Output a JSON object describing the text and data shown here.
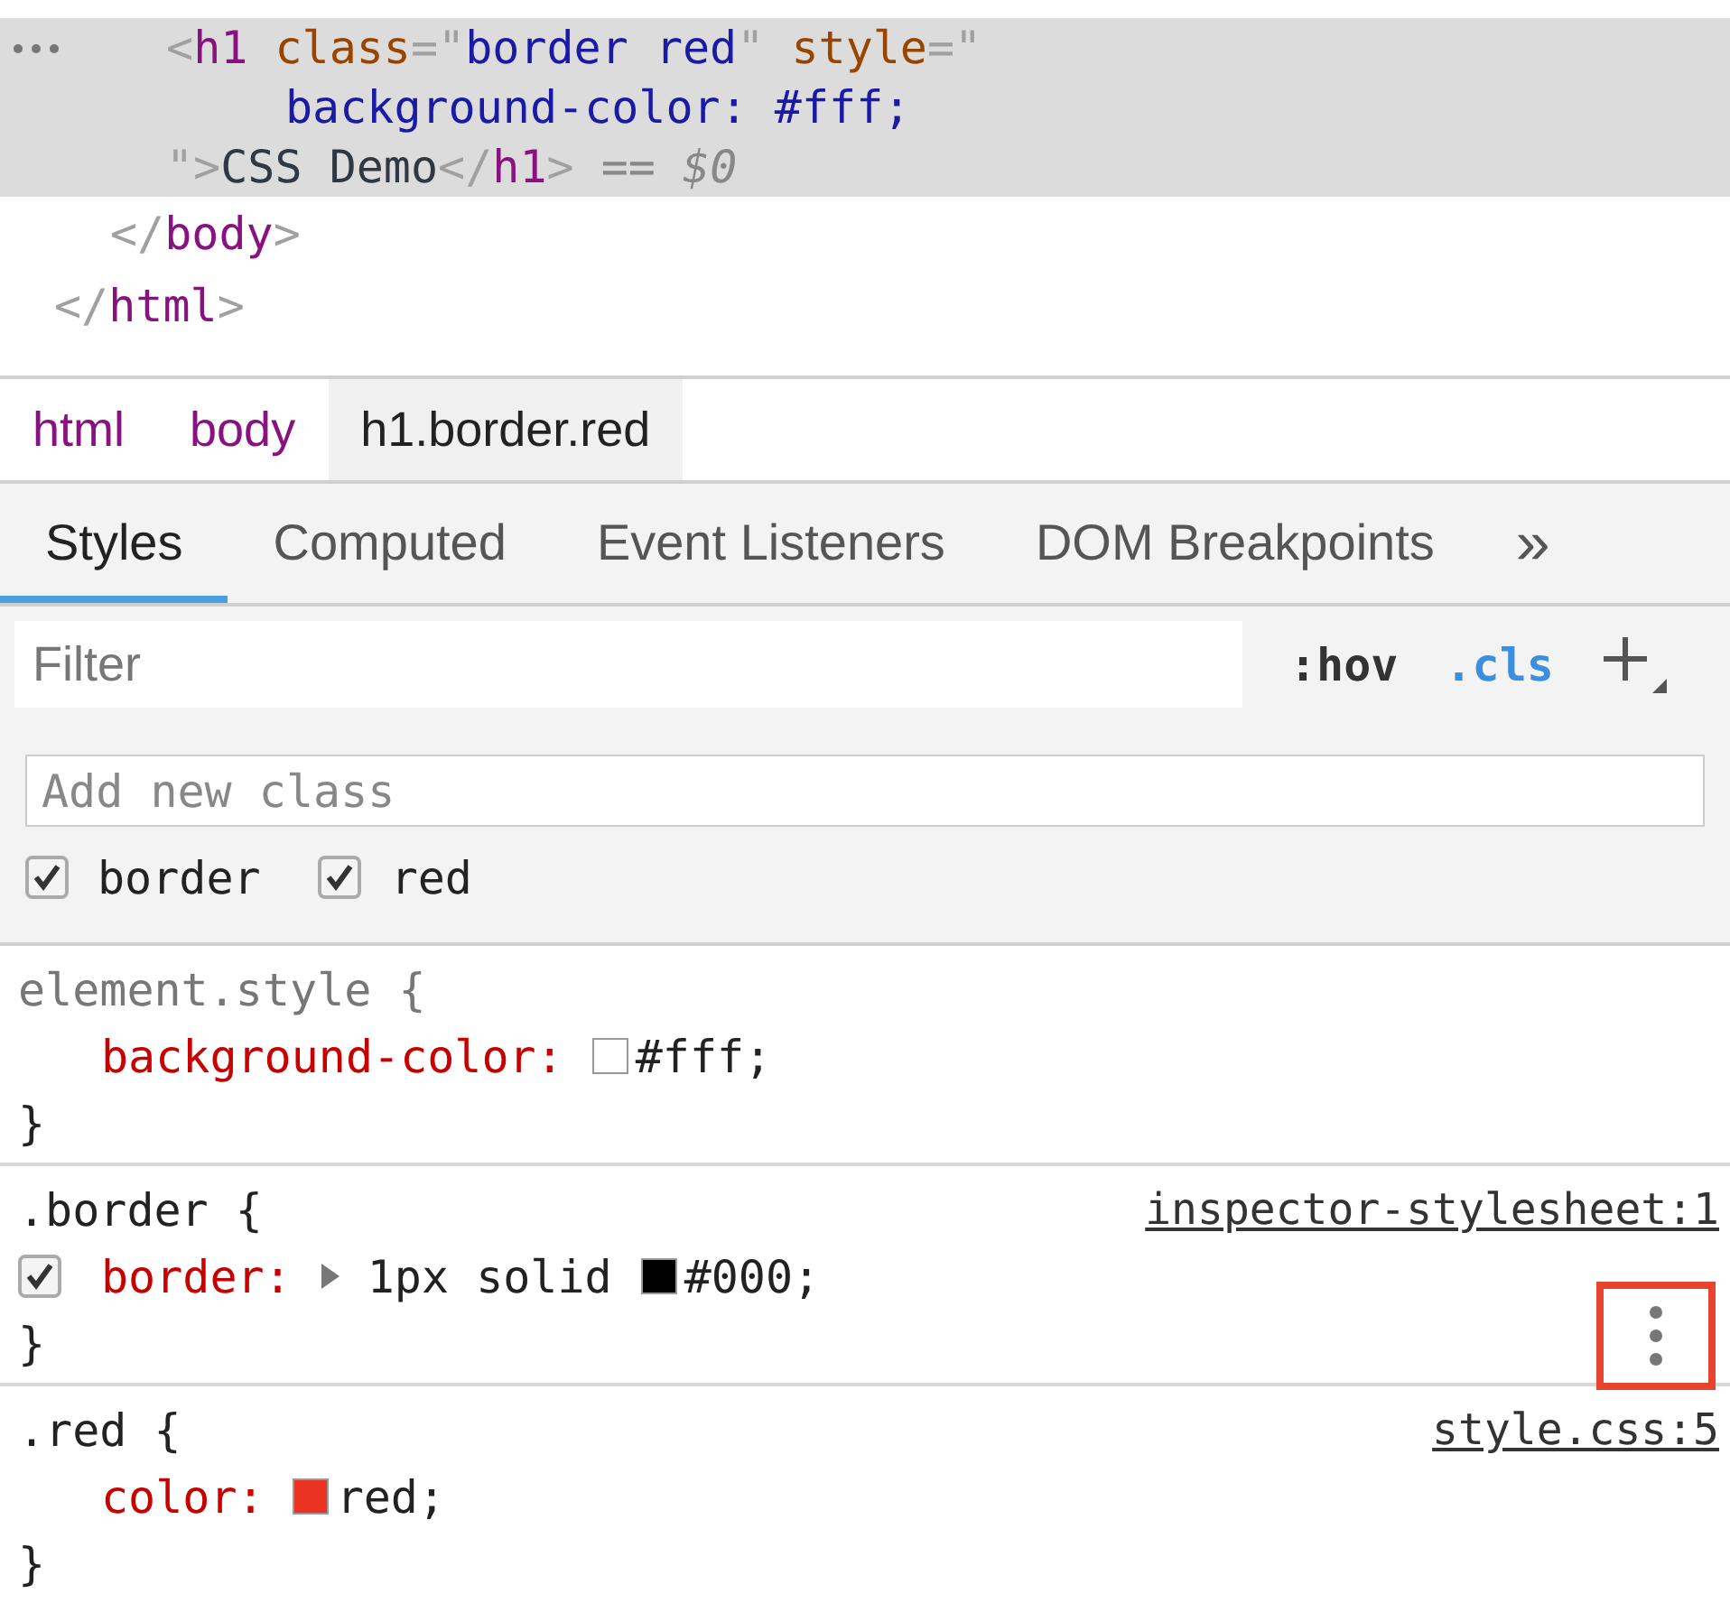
{
  "elements_tree": {
    "close_tokens": [
      {
        "kind": "punct",
        "text": "</"
      },
      {
        "kind": "tag",
        "text": "html"
      },
      {
        "kind": "punct",
        "text": ">"
      }
    ],
    "children": [
      {
        "close_tokens": [
          {
            "kind": "punct",
            "text": "</"
          },
          {
            "kind": "tag",
            "text": "body"
          },
          {
            "kind": "punct",
            "text": ">"
          }
        ],
        "children": [
          {
            "selected": true,
            "lines": [
              {
                "kind": "start",
                "tokens": [
                  {
                    "kind": "punct",
                    "text": "<"
                  },
                  {
                    "kind": "tag",
                    "text": "h1"
                  },
                  {
                    "kind": "attr",
                    "text": " class"
                  },
                  {
                    "kind": "punct",
                    "text": "=\""
                  },
                  {
                    "kind": "value",
                    "text": "border red"
                  },
                  {
                    "kind": "punct",
                    "text": "\""
                  },
                  {
                    "kind": "attr",
                    "text": " style"
                  },
                  {
                    "kind": "punct",
                    "text": "=\""
                  }
                ]
              },
              {
                "kind": "continuation",
                "tokens": [
                  {
                    "kind": "value",
                    "text": "background-color: #fff;"
                  }
                ]
              },
              {
                "kind": "start",
                "tokens": [
                  {
                    "kind": "punct",
                    "text": "\">"
                  },
                  {
                    "kind": "text",
                    "text": "CSS Demo"
                  },
                  {
                    "kind": "punct",
                    "text": "</"
                  },
                  {
                    "kind": "tag",
                    "text": "h1"
                  },
                  {
                    "kind": "punct",
                    "text": ">"
                  },
                  {
                    "kind": "op",
                    "text": " == "
                  },
                  {
                    "kind": "var",
                    "text": "$0"
                  }
                ]
              }
            ]
          }
        ]
      }
    ]
  },
  "breadcrumbs": [
    {
      "label": "html",
      "selected": false
    },
    {
      "label": "body",
      "selected": false
    },
    {
      "label": "h1.border.red",
      "selected": true
    }
  ],
  "tabs": [
    {
      "label": "Styles",
      "selected": true
    },
    {
      "label": "Computed",
      "selected": false
    },
    {
      "label": "Event Listeners",
      "selected": false
    },
    {
      "label": "DOM Breakpoints",
      "selected": false
    }
  ],
  "tabs_overflow": "»",
  "filter": {
    "placeholder": "Filter"
  },
  "toggles": [
    {
      "label": ":hov",
      "selected": false
    },
    {
      "label": ".cls",
      "selected": true
    }
  ],
  "add_class": {
    "placeholder": "Add new class"
  },
  "classes": [
    {
      "name": "border",
      "checked": true
    },
    {
      "name": "red",
      "checked": true
    }
  ],
  "rules": [
    {
      "selector": "element.style {",
      "kind": "inline",
      "close": "}",
      "declarations": [
        {
          "property": "background-color:",
          "color": "#ffffff",
          "value": "#fff;"
        }
      ]
    },
    {
      "selector": ".border {",
      "kind": "sheet",
      "source": "inspector-stylesheet:1",
      "close": "}",
      "menu_highlighted": true,
      "declarations": [
        {
          "property": "border:",
          "checked": true,
          "expandable": true,
          "value_prefix": "1px solid",
          "color": "#000000",
          "value": "#000;"
        }
      ]
    },
    {
      "selector": ".red {",
      "kind": "sheet",
      "source": "style.css:5",
      "close": "}",
      "declarations": [
        {
          "property": "color:",
          "color": "#ea3323",
          "value": "red;"
        }
      ]
    }
  ]
}
